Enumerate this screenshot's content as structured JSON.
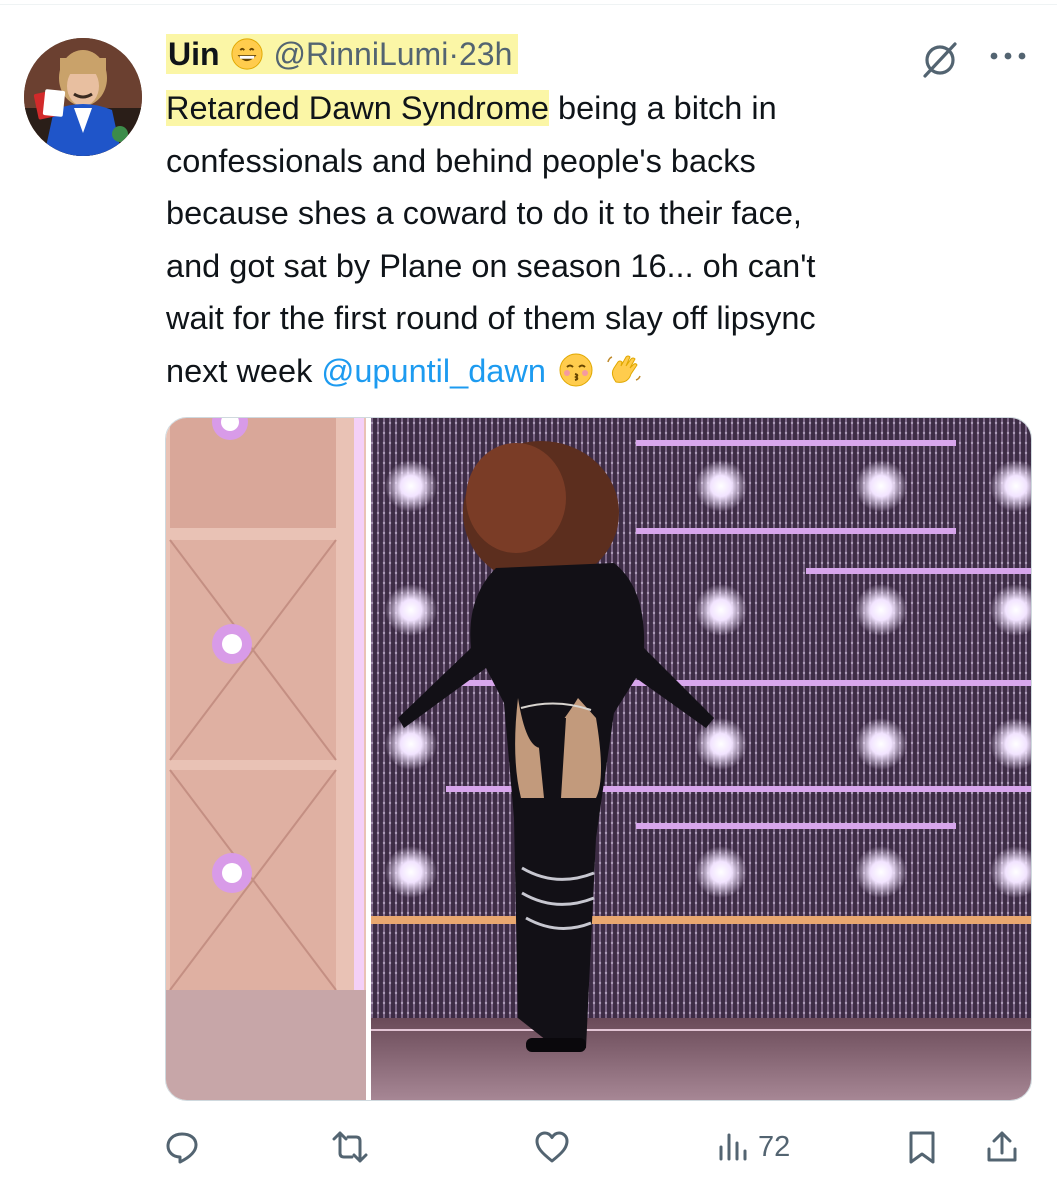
{
  "tweet": {
    "display_name": "Uin",
    "name_emoji": "grinning-face-emoji",
    "handle": "@RinniLumi",
    "separator": "·",
    "time": "23h",
    "lines": [
      {
        "pre": "Retarded Dawn Syndrome",
        "post": " being a bitch in"
      },
      {
        "text": "confessionals and behind people's backs"
      },
      {
        "text": "because shes a coward to do it to their face,"
      },
      {
        "text": "and got sat by Plane on season 16... oh can't"
      },
      {
        "text": "wait for the first round of them slay off lipsync"
      },
      {
        "pre": "next week ",
        "mention": "@upuntil_dawn"
      }
    ],
    "trailing_emojis": [
      "kissing-face-emoji",
      "waving-hand-emoji"
    ],
    "highlight_color": "#fbf6a6"
  },
  "media": {
    "description_icon": "stage-photo",
    "accent": "#b07cc6"
  },
  "actions": {
    "reply_count": "",
    "retweet_count": "",
    "like_count": "",
    "views_count": "72"
  },
  "colors": {
    "text": "#0f1419",
    "muted": "#536471",
    "link": "#1d9bf0"
  }
}
